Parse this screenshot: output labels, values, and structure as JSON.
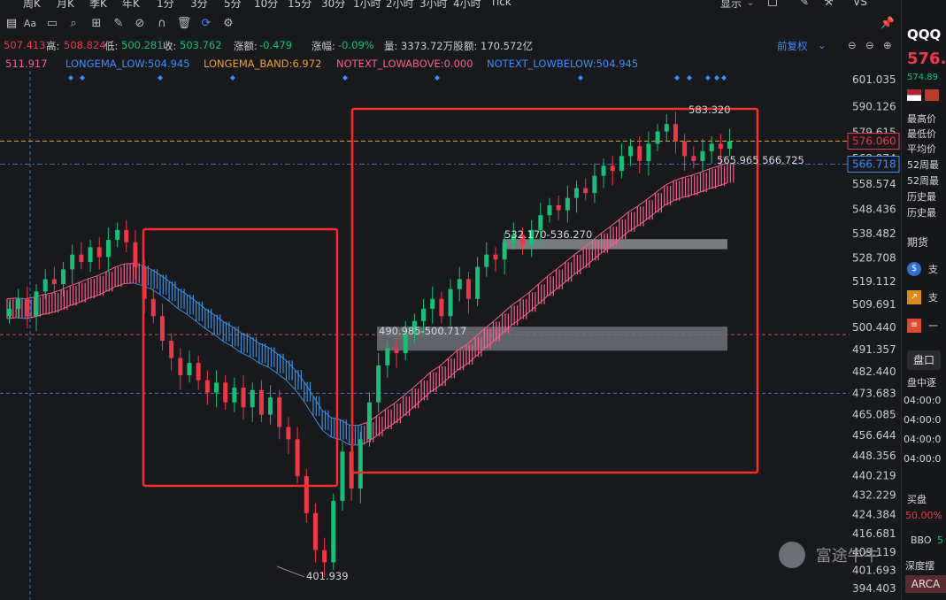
{
  "tabs": [
    "周K",
    "月K",
    "季K",
    "年K",
    "1分",
    "3分",
    "5分",
    "10分",
    "15分",
    "30分",
    "1小时",
    "2小时",
    "3小时",
    "4小时",
    "Tick"
  ],
  "display_menu": "显示",
  "vs_label": "VS",
  "info": {
    "open_value": "507.413",
    "high_label": "高:",
    "high_value": "508.824",
    "low_label": "低:",
    "low_value": "500.281",
    "close_label": "收:",
    "close_value": "503.762",
    "change_label": "涨额:",
    "change_value": "-0.479",
    "pct_label": "涨幅:",
    "pct_value": "-0.09%",
    "volume": "量: 3373.72万股",
    "amount": "额: 170.572亿",
    "adjust": "前复权"
  },
  "indicators": {
    "first": "511.917",
    "low": "LONGEMA_LOW:504.945",
    "band": "LONGEMA_BAND:6.972",
    "above": "NOTEXT_LOWABOVE:0.000",
    "below": "NOTEXT_LOWBELOW:504.945"
  },
  "price_labels": {
    "current": "576.060",
    "current_color": "#f23645",
    "ref": "566.718",
    "ref_color": "#3d8bff",
    "ema_pair": "565.965  566.725",
    "zone_upper": "532.170-536.270",
    "zone_lower": "490.985-500.717",
    "low_marker": "401.939",
    "high_marker": "583.320"
  },
  "right_panel": {
    "symbol": "QQQ",
    "price": "576.",
    "prev": "574.89",
    "stats": [
      "最高价",
      "最低价",
      "平均价",
      "52周最",
      "52周最",
      "历史最",
      "历史最"
    ],
    "futures": "期货",
    "order_book_tab": "盘口",
    "order_book_sub": "盘中逐",
    "times": [
      "04:00:0",
      "04:00:0",
      "04:00:0",
      "04:00:0"
    ],
    "bid_title": "买盘",
    "bid_pct": "50.00%",
    "bbo": "BBO",
    "depth": "深度摆",
    "arca": "ARCA"
  },
  "watermark": "富途牛牛",
  "colors": {
    "up": "#13c277",
    "down": "#f23645",
    "band_up": "#ff5c8a",
    "band_down": "#3b8fe0",
    "highlight_box": "#ff2a2a"
  },
  "chart_data": {
    "type": "candlestick",
    "y_ticks": [
      "601.035",
      "590.126",
      "579.615",
      "568.974",
      "558.574",
      "548.436",
      "538.482",
      "528.708",
      "519.112",
      "509.691",
      "500.440",
      "491.357",
      "482.440",
      "473.683",
      "465.085",
      "456.644",
      "448.356",
      "440.219",
      "432.229",
      "424.384",
      "416.681",
      "409.119",
      "401.693",
      "394.403"
    ],
    "ylim": [
      394.403,
      601.035
    ],
    "horizontal_lines": [
      576.06,
      566.718,
      497.5,
      473.683
    ],
    "annotations": [
      "583.320",
      "565.965",
      "566.725",
      "532.170-536.270",
      "490.985-500.717",
      "401.939"
    ],
    "close_path": [
      508,
      512,
      505,
      515,
      520,
      518,
      524,
      530,
      527,
      533,
      529,
      536,
      540,
      535,
      525,
      512,
      505,
      495,
      488,
      481,
      486,
      479,
      474,
      478,
      470,
      476,
      468,
      475,
      465,
      472,
      460,
      455,
      440,
      425,
      410,
      405,
      430,
      450,
      435,
      455,
      470,
      485,
      492,
      490,
      498,
      503,
      508,
      512,
      505,
      516,
      520,
      512,
      525,
      530,
      528,
      535,
      538,
      534,
      540,
      546,
      550,
      548,
      553,
      557,
      555,
      562,
      566,
      564,
      570,
      574,
      568,
      575,
      580,
      583,
      576,
      570,
      568,
      572,
      575,
      573,
      576
    ]
  }
}
